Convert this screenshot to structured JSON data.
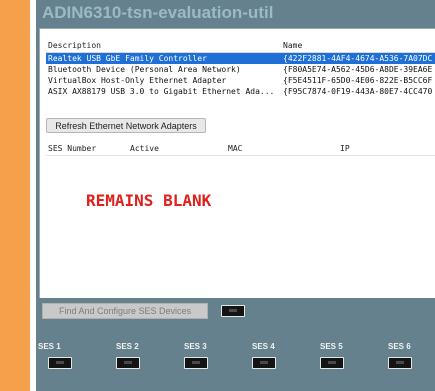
{
  "window": {
    "title": "ADIN6310-tsn-evaluation-util"
  },
  "adapters": {
    "columns": [
      "Description",
      "Name"
    ],
    "rows": [
      {
        "description": "Realtek USB GbE Family Controller",
        "name": "{422F2881-4AF4-4674-A536-7A07DC",
        "selected": true
      },
      {
        "description": "Bluetooth Device (Personal Area Network)",
        "name": "{F80A5E74-A562-45D6-A8DE-39EA6E",
        "selected": false
      },
      {
        "description": "VirtualBox Host-Only Ethernet Adapter",
        "name": "{F5E4511F-65D0-4E06-822E-B5CC6F",
        "selected": false
      },
      {
        "description": "ASIX AX88179 USB 3.0 to Gigabit Ethernet Ada...",
        "name": "{F95C7874-0F19-443A-80E7-4CC470",
        "selected": false
      }
    ]
  },
  "refresh_button": {
    "label": "Refresh Ethernet Network Adapters"
  },
  "ses_table": {
    "columns": [
      "SES Number",
      "Active",
      "MAC",
      "IP"
    ],
    "annotation": "REMAINS BLANK"
  },
  "find_button": {
    "label": "Find And Configure SES Devices"
  },
  "ses_slots": [
    "SES 1",
    "SES 2",
    "SES 3",
    "SES 4",
    "SES 5",
    "SES 6"
  ],
  "colors": {
    "left_stripe": "#f5a04a",
    "window_bg": "#64818d",
    "title": "#9bbac7",
    "selection": "#1e6fd6",
    "annotation": "#e0201c"
  }
}
